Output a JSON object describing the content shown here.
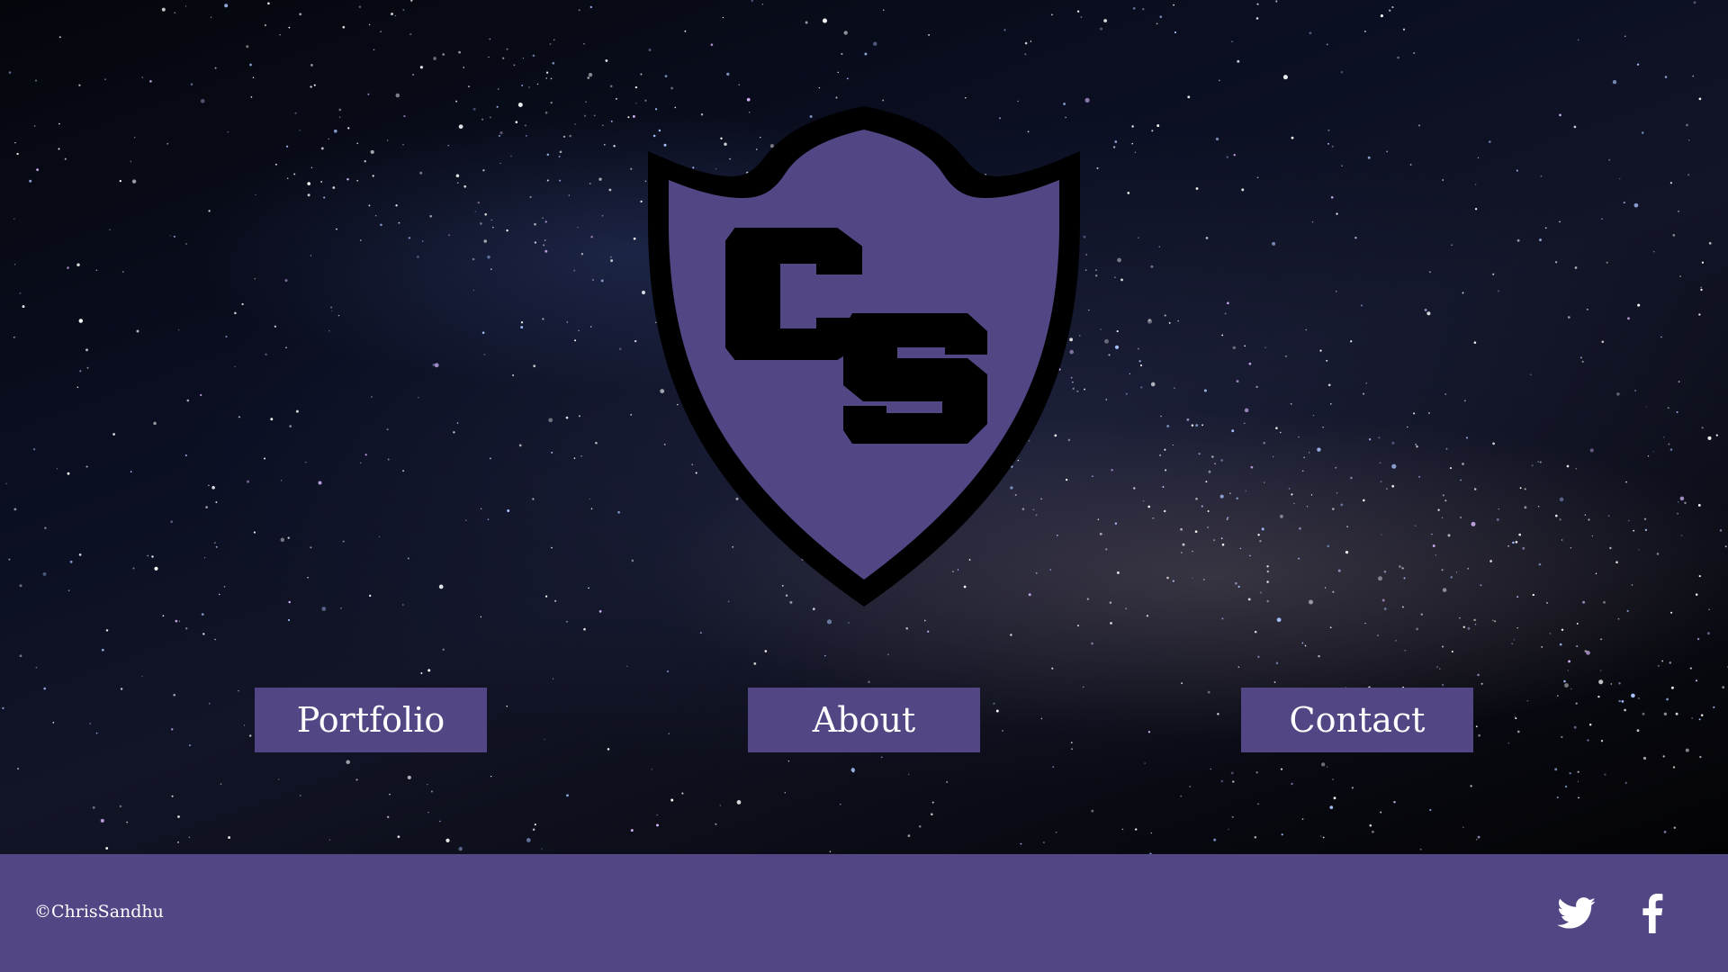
{
  "brand": {
    "logo_text": "CS",
    "primary_color": "#534685",
    "shield_outline_color": "#000000"
  },
  "nav": {
    "items": [
      {
        "label": "Portfolio"
      },
      {
        "label": "About"
      },
      {
        "label": "Contact"
      }
    ]
  },
  "footer": {
    "copyright": "©ChrisSandhu",
    "social": [
      {
        "icon": "twitter-icon"
      },
      {
        "icon": "facebook-icon"
      }
    ]
  }
}
